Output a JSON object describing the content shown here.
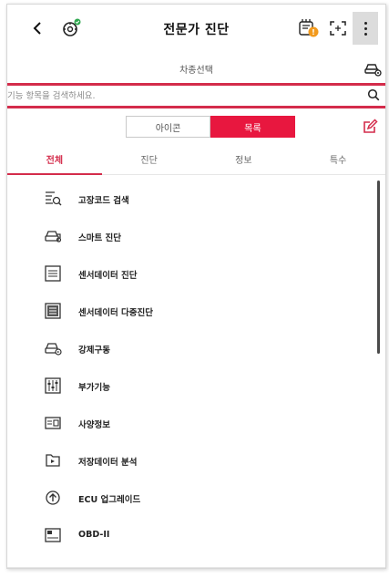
{
  "header": {
    "title": "전문가 진단"
  },
  "vehicle": {
    "label": "차종선택"
  },
  "search": {
    "placeholder": "기능 항목을 검색하세요."
  },
  "view_toggle": {
    "icon_label": "아이콘",
    "list_label": "목록",
    "selected": "목록"
  },
  "tabs": [
    {
      "label": "전체",
      "active": true
    },
    {
      "label": "진단",
      "active": false
    },
    {
      "label": "정보",
      "active": false
    },
    {
      "label": "특수",
      "active": false
    }
  ],
  "items": [
    {
      "label": "고장코드 검색",
      "icon": "dtc-search-icon"
    },
    {
      "label": "스마트 진단",
      "icon": "smart-diagnosis-icon"
    },
    {
      "label": "센서데이터 진단",
      "icon": "sensor-data-icon"
    },
    {
      "label": "센서데이터 다중진단",
      "icon": "sensor-data-multi-icon"
    },
    {
      "label": "강제구동",
      "icon": "actuation-test-icon"
    },
    {
      "label": "부가기능",
      "icon": "additional-functions-icon"
    },
    {
      "label": "사양정보",
      "icon": "spec-info-icon"
    },
    {
      "label": "저장데이터 분석",
      "icon": "saved-data-folder-icon"
    },
    {
      "label": "ECU 업그레이드",
      "icon": "ecu-upgrade-icon"
    },
    {
      "label": "OBD-II",
      "icon": "obd-icon"
    }
  ],
  "colors": {
    "accent": "#e8173f",
    "divider_red": "#d42c4b"
  }
}
